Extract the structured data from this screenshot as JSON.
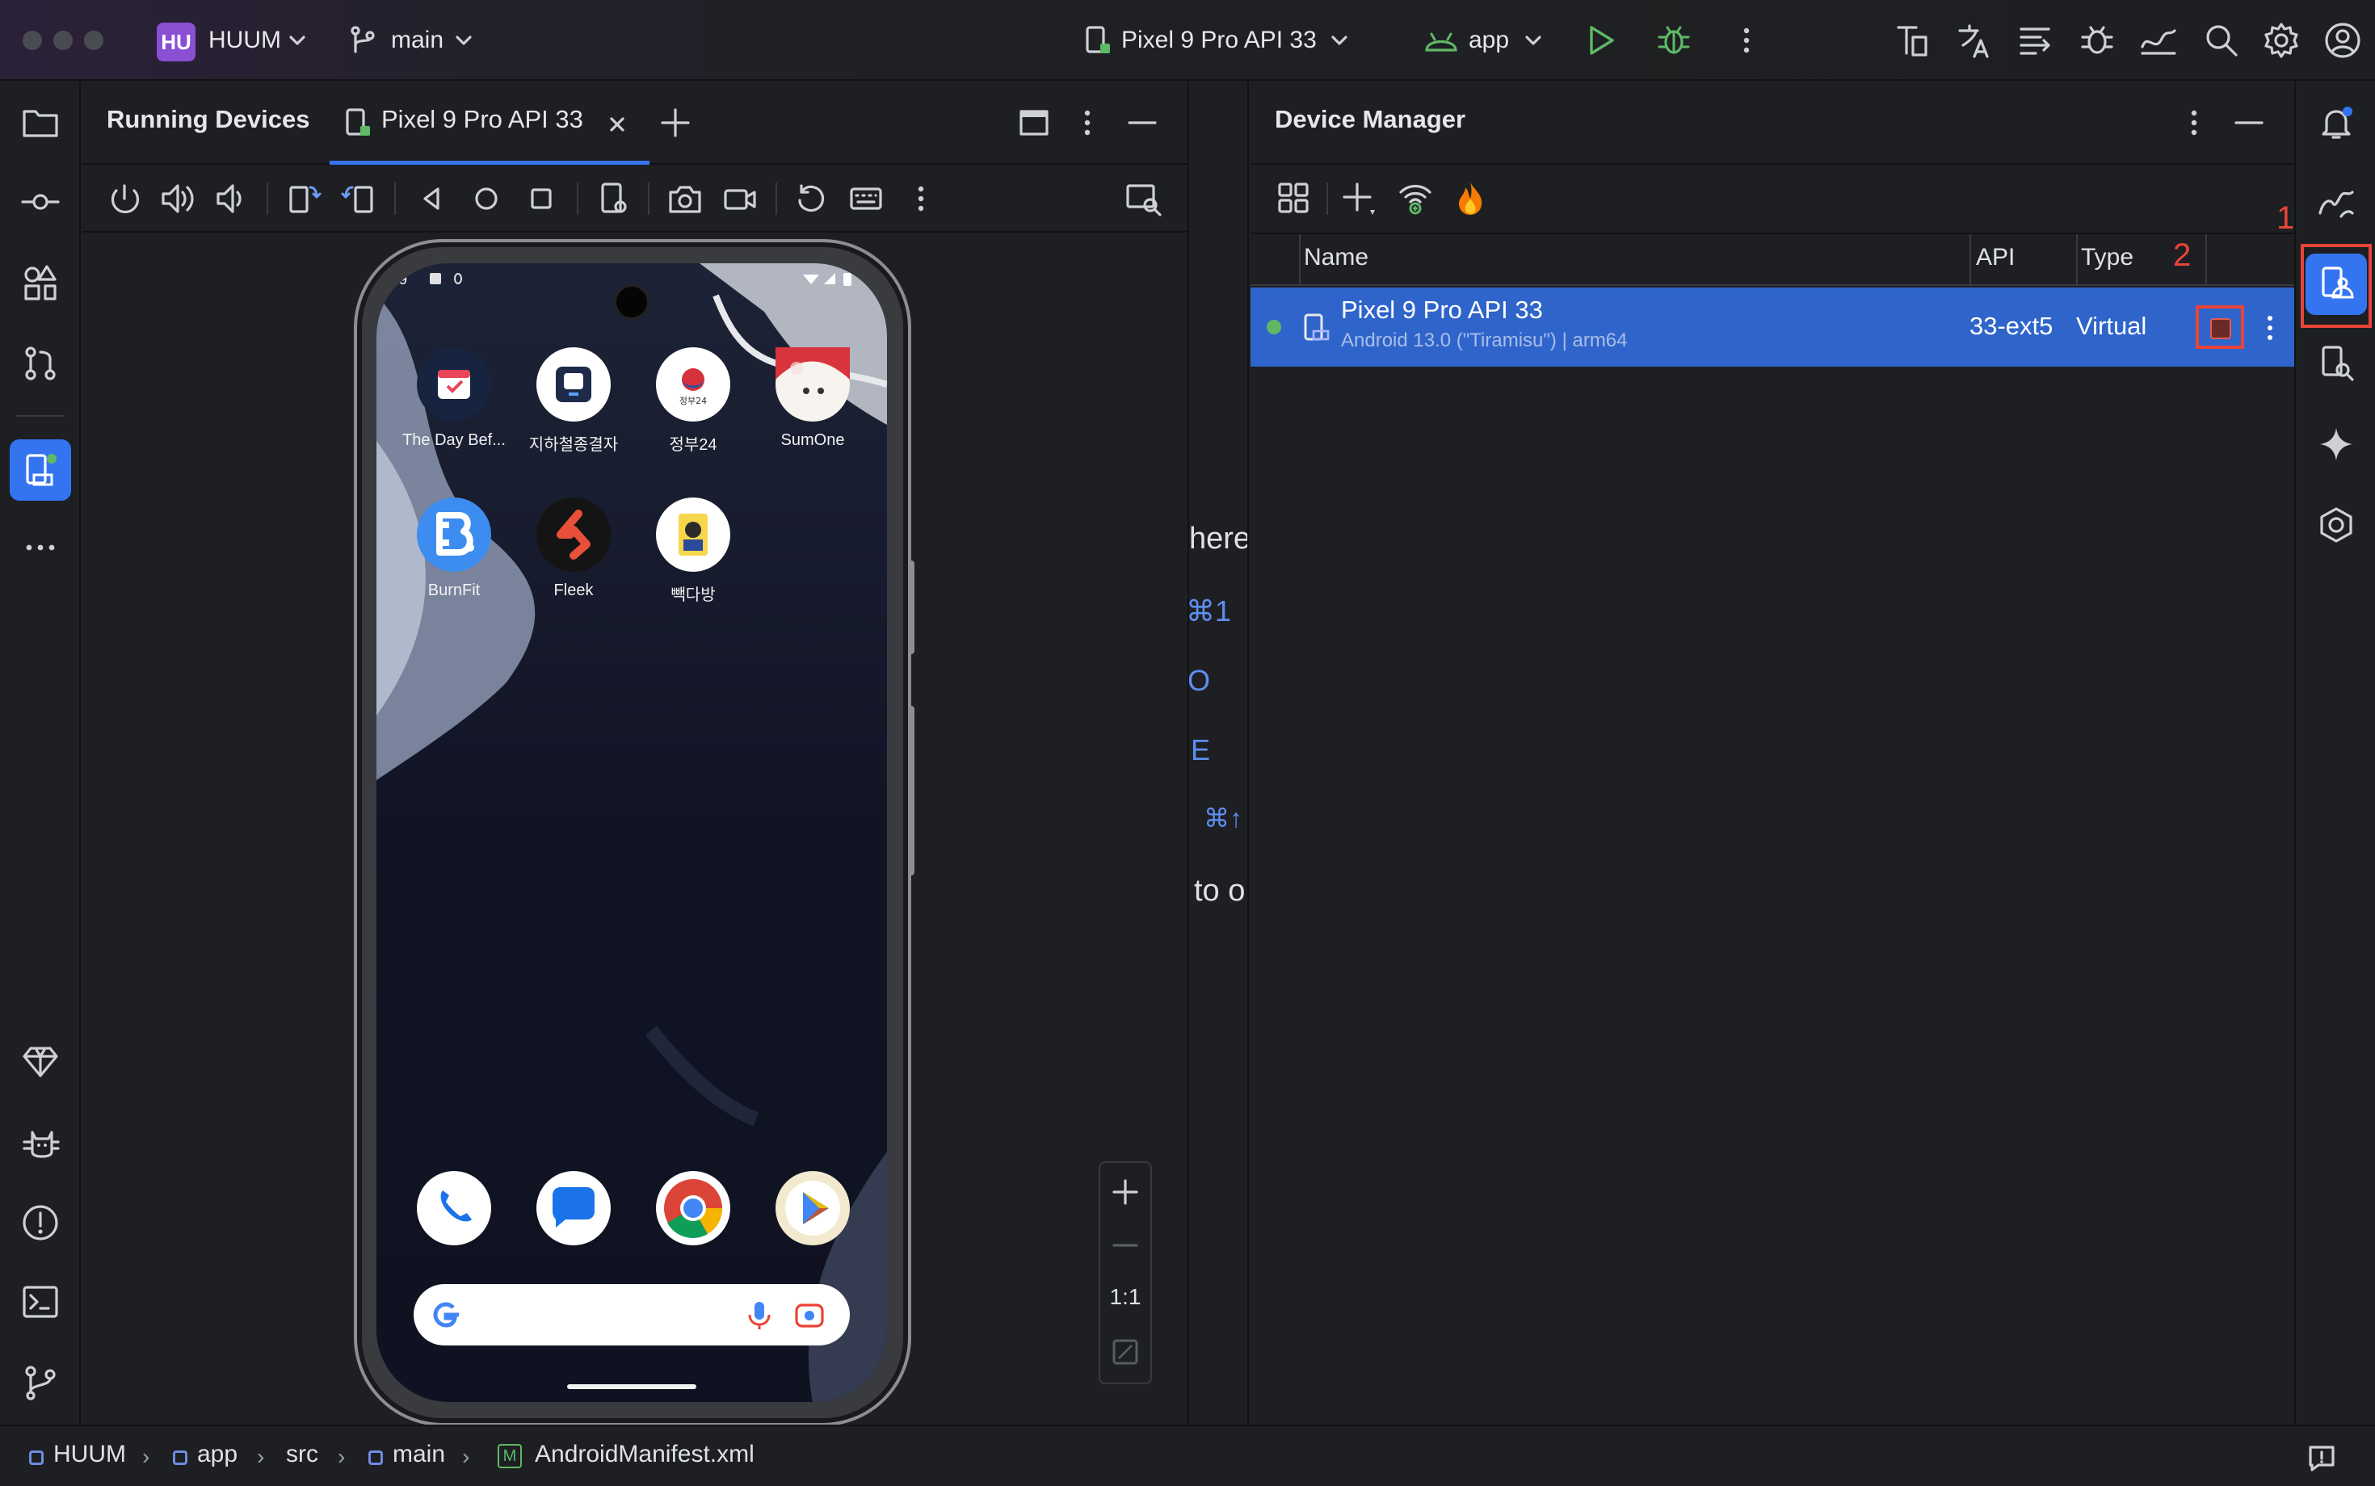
{
  "titlebar": {
    "project_badge": "HU",
    "project_name": "HUUM",
    "branch": "main",
    "device_selector": "Pixel 9 Pro API 33",
    "run_config": "app"
  },
  "running_devices": {
    "title": "Running Devices",
    "tab_label": "Pixel 9 Pro API 33"
  },
  "emulator": {
    "apps_row1": [
      {
        "label": "The Day Bef...",
        "icon": "calendar-app-icon"
      },
      {
        "label": "지하철종결자",
        "icon": "subway-app-icon"
      },
      {
        "label": "정부24",
        "icon": "gov24-app-icon"
      },
      {
        "label": "SumOne",
        "icon": "sumone-app-icon"
      }
    ],
    "apps_row2": [
      {
        "label": "BurnFit",
        "icon": "burnfit-app-icon"
      },
      {
        "label": "Fleek",
        "icon": "fleek-app-icon"
      },
      {
        "label": "빽다방",
        "icon": "paikdabang-app-icon"
      }
    ],
    "status_time": "9",
    "zoom_label": "1:1"
  },
  "middle_hint": {
    "lines": [
      "here",
      "⌘1",
      "O",
      "E",
      "⌘↑",
      "to o"
    ]
  },
  "device_manager": {
    "title": "Device Manager",
    "columns": {
      "name": "Name",
      "api": "API",
      "type": "Type"
    },
    "rows": [
      {
        "name": "Pixel 9 Pro API 33",
        "details": "Android 13.0 (\"Tiramisu\") | arm64",
        "api": "33-ext5",
        "type": "Virtual",
        "status_color": "#5fb865"
      }
    ],
    "annotation_1": "1",
    "annotation_2": "2"
  },
  "breadcrumb": {
    "items": [
      "HUUM",
      "app",
      "src",
      "main",
      "AndroidManifest.xml"
    ],
    "file_badge": "M"
  },
  "colors": {
    "accent": "#3574f0",
    "selection": "#2f65ca",
    "annotation_red": "#e8443a"
  }
}
